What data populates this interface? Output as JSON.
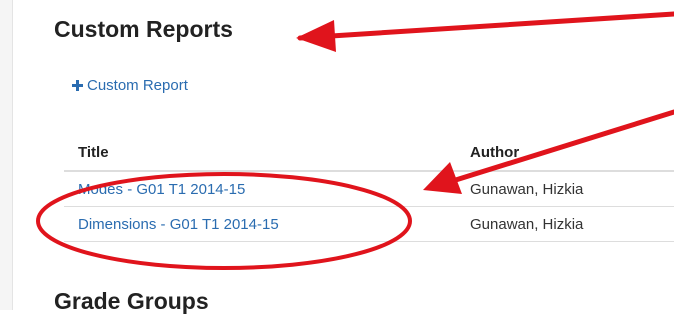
{
  "section": {
    "title": "Custom Reports",
    "add_label": "Custom Report"
  },
  "table": {
    "headers": [
      "Title",
      "Author"
    ],
    "rows": [
      {
        "title": "Modes - G01 T1 2014-15",
        "author": "Gunawan, Hizkia"
      },
      {
        "title": "Dimensions - G01 T1 2014-15",
        "author": "Gunawan, Hizkia"
      }
    ]
  },
  "next_section": {
    "title": "Grade Groups"
  },
  "annotation": {
    "color": "#e0141c"
  }
}
